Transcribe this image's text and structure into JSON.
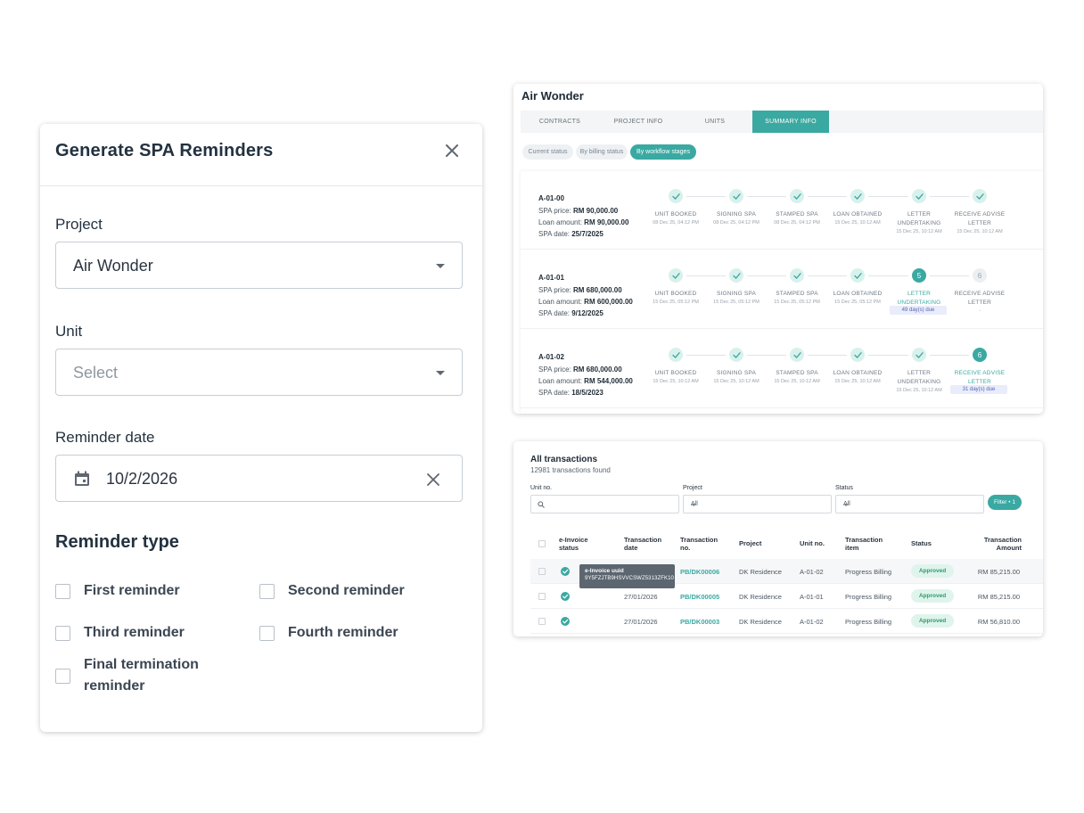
{
  "modal": {
    "title": "Generate SPA Reminders",
    "project_label": "Project",
    "project_value": "Air Wonder",
    "unit_label": "Unit",
    "unit_placeholder": "Select",
    "date_label": "Reminder date",
    "date_value": "10/2/2026",
    "type_title": "Reminder type",
    "options": [
      {
        "label": "First reminder",
        "checked": false
      },
      {
        "label": "Second reminder",
        "checked": false
      },
      {
        "label": "Third reminder",
        "checked": false
      },
      {
        "label": "Fourth reminder",
        "checked": false
      },
      {
        "label": "Final termination reminder",
        "checked": false
      }
    ]
  },
  "project_panel": {
    "title": "Air Wonder",
    "tabs": [
      "CONTRACTS",
      "PROJECT INFO",
      "UNITS",
      "SUMMARY INFO"
    ],
    "active_tab": "SUMMARY INFO",
    "filters": [
      "Current status",
      "By billing status",
      "By workflow stages"
    ],
    "active_filter": "By workflow stages",
    "price_label": "SPA price:",
    "loan_label": "Loan amount:",
    "date_label": "SPA date:",
    "units": [
      {
        "name": "A-01-00",
        "price": "RM 90,000.00",
        "loan": "RM 90,000.00",
        "date": "25/7/2025",
        "stages": [
          {
            "name": "UNIT BOOKED",
            "state": "done",
            "date": "08 Dec 25, 04:12 PM"
          },
          {
            "name": "SIGNING SPA",
            "state": "done",
            "date": "08 Dec 25, 04:12 PM"
          },
          {
            "name": "STAMPED SPA",
            "state": "done",
            "date": "08 Dec 25, 04:12 PM"
          },
          {
            "name": "LOAN OBTAINED",
            "state": "done",
            "date": "15 Dec 25, 10:12 AM"
          },
          {
            "name": "LETTER UNDERTAKING",
            "state": "done",
            "date": "15 Dec 25, 10:12 AM"
          },
          {
            "name": "RECEIVE ADVISE LETTER",
            "state": "done",
            "date": "15 Dec 25, 10:12 AM"
          }
        ]
      },
      {
        "name": "A-01-01",
        "price": "RM 680,000.00",
        "loan": "RM 600,000.00",
        "date": "9/12/2025",
        "stages": [
          {
            "name": "UNIT BOOKED",
            "state": "done",
            "date": "15 Dec 25, 05:12 PM"
          },
          {
            "name": "SIGNING SPA",
            "state": "done",
            "date": "15 Dec 25, 05:12 PM"
          },
          {
            "name": "STAMPED SPA",
            "state": "done",
            "date": "15 Dec 25, 05:12 PM"
          },
          {
            "name": "LOAN OBTAINED",
            "state": "done",
            "date": "15 Dec 25, 05:12 PM"
          },
          {
            "name": "LETTER UNDERTAKING",
            "state": "current",
            "number": "5",
            "due": "49 day(s) due"
          },
          {
            "name": "RECEIVE ADVISE LETTER",
            "state": "pending",
            "number": "6",
            "date": "-"
          }
        ]
      },
      {
        "name": "A-01-02",
        "price": "RM 680,000.00",
        "loan": "RM 544,000.00",
        "date": "18/5/2023",
        "stages": [
          {
            "name": "UNIT BOOKED",
            "state": "done",
            "date": "15 Dec 25, 10:12 AM"
          },
          {
            "name": "SIGNING SPA",
            "state": "done",
            "date": "15 Dec 25, 10:12 AM"
          },
          {
            "name": "STAMPED SPA",
            "state": "done",
            "date": "15 Dec 25, 10:12 AM"
          },
          {
            "name": "LOAN OBTAINED",
            "state": "done",
            "date": "15 Dec 25, 10:12 AM"
          },
          {
            "name": "LETTER UNDERTAKING",
            "state": "done",
            "date": "15 Dec 25, 10:12 AM"
          },
          {
            "name": "RECEIVE ADVISE LETTER",
            "state": "current",
            "number": "6",
            "due": "31 day(s) due"
          }
        ]
      }
    ]
  },
  "transactions": {
    "title": "All transactions",
    "count": "12981 transactions found",
    "unit_label": "Unit no.",
    "project_label": "Project",
    "project_value": "All",
    "status_label": "Status",
    "status_value": "All",
    "filter_button": "Filter • 1",
    "headers": [
      "e-Invoice status",
      "Transaction date",
      "Transaction no.",
      "Project",
      "Unit no.",
      "Transaction item",
      "Status",
      "Transaction Amount"
    ],
    "tooltip_title": "e-Invoice uuid",
    "tooltip_value": "9Y5FZJTB9HSVVCSWZ5313ZFK10",
    "rows": [
      {
        "date": "",
        "no": "PB/DK00006",
        "project": "DK Residence",
        "unit": "A-01-02",
        "item": "Progress Billing",
        "status": "Approved",
        "amount": "RM 85,215.00"
      },
      {
        "date": "27/01/2026",
        "no": "PB/DK00005",
        "project": "DK Residence",
        "unit": "A-01-01",
        "item": "Progress Billing",
        "status": "Approved",
        "amount": "RM 85,215.00"
      },
      {
        "date": "27/01/2026",
        "no": "PB/DK00003",
        "project": "DK Residence",
        "unit": "A-01-02",
        "item": "Progress Billing",
        "status": "Approved",
        "amount": "RM 56,810.00"
      }
    ]
  },
  "colors": {
    "accent": "#3aa9a2",
    "approved_bg": "#dff4ec",
    "due_bg": "#e9ecfa"
  }
}
